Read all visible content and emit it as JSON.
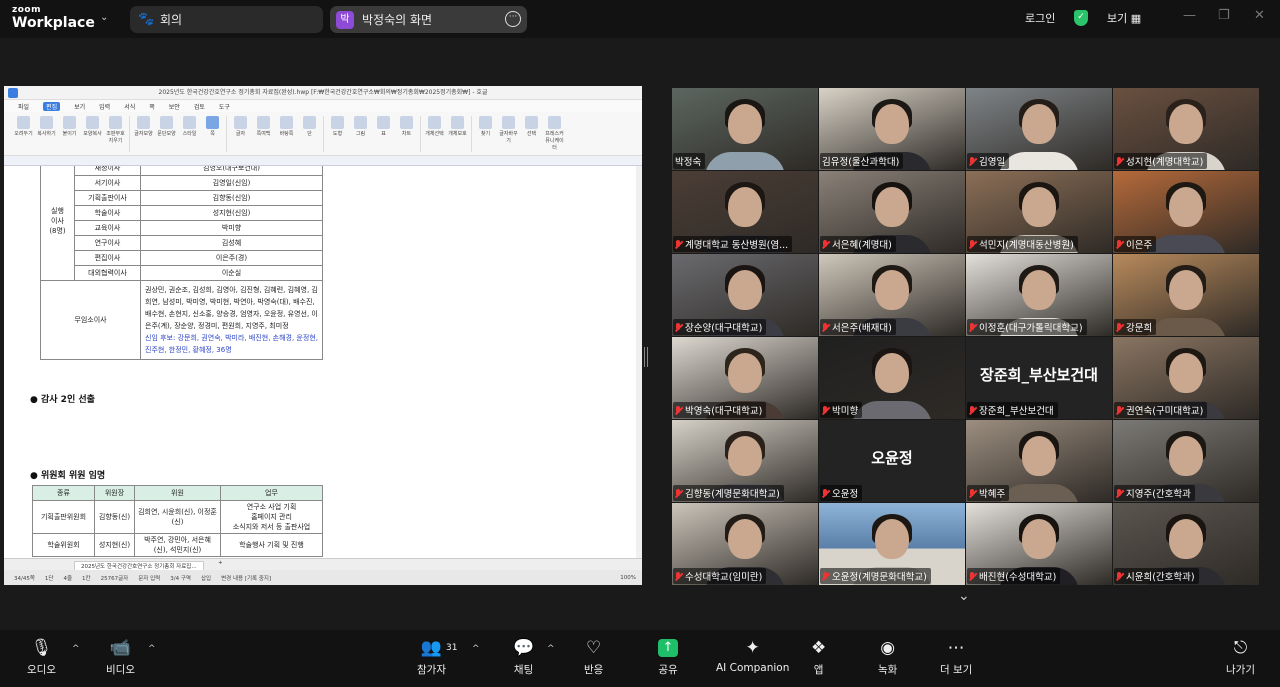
{
  "topbar": {
    "logo_line1": "zoom",
    "logo_line2": "Workplace",
    "meeting_tab": "회의",
    "share_tab": "박정숙의 화면",
    "share_tab_badge": "박",
    "login": "로그인",
    "view": "보기",
    "security_color": "#2bc46b"
  },
  "doc": {
    "title_bar": "2025년도 한국건강간호연구소 정기총회 자료집(완성).hwp [F:₩한국건강간호연구소₩회의₩정기총회₩2025정기총회₩] - 호글",
    "menu": [
      "파일",
      "편집",
      "보기",
      "입력",
      "서식",
      "쪽",
      "보안",
      "검토",
      "도구"
    ],
    "menu_active": 1,
    "ribbon": [
      "오려두기",
      "복사하기",
      "붙이기",
      "모양복사",
      "조판부호지우기",
      "글자모양",
      "문단모양",
      "스타일",
      "쪽",
      "글자",
      "쪽여백",
      "바탕쪽",
      "단",
      "도형",
      "그림",
      "표",
      "차트",
      "개체선택",
      "개체보호",
      "찾기",
      "글자바꾸기",
      "선택",
      "프레스커뮤니케이터"
    ],
    "table1": {
      "group_label": "실행\n이사\n(8명)",
      "rows": [
        {
          "role": "재정이사",
          "person": "김영오(대구보건대)",
          "blue": false
        },
        {
          "role": "서기이사",
          "person": "김영일(신임)",
          "blue": true
        },
        {
          "role": "기획출판이사",
          "person": "김향동(신임)",
          "blue": true,
          "role_blue": true
        },
        {
          "role": "학술이사",
          "person": "성지현(신임)",
          "blue": true
        },
        {
          "role": "교육이사",
          "person": "박미향",
          "blue": false
        },
        {
          "role": "연구이사",
          "person": "김성혜",
          "blue": false
        },
        {
          "role": "편집이사",
          "person": "이은주(경)",
          "blue": false,
          "role_blue": true
        },
        {
          "role": "대외협력이사",
          "person": "이순실",
          "blue": false
        }
      ],
      "board_label": "무임소이사",
      "board_list": "권상민, 권순조, 김성희, 김영아, 김진형, 김혜련, 김혜영, 김희연, 남성미, 박미영, 박미현, 박연아, 박영숙(대), 배수진, 배수현, 손현지, 신소홍, 양승경, 엄영자, 오윤정, 유영선, 이은주(계), 장순양, 정경미, 편원희, 지영주, 최미정",
      "board_list_blue": "신임 후보: 강문희, 권연숙, 박미라, 배진현, 손해경, 윤정현, 진주현, 한정민, 황혜정, 36명"
    },
    "section2": "●  감사 2인 선출",
    "section3": "●  위원회 위원 임명",
    "table2": {
      "headers": [
        "종류",
        "위원장",
        "위원",
        "업무"
      ],
      "rows": [
        {
          "kind": "기획출판위원회",
          "chair": "김향동(신)",
          "members": "김희연, 시윤희(신), 이정훈(신)",
          "duty": "연구소 사업 기획\n홈페이지 관리\n소식지와 저서 등 출판사업"
        },
        {
          "kind": "학술위원회",
          "chair": "성지현(신)",
          "members": "박주연, 강민아, 서은혜(신), 석민지(신)",
          "duty": "학술행사 기획 및 진행"
        }
      ]
    },
    "tab_name": "2025년도 한국건강간호연구소 정기총회 자료집...",
    "status": [
      "34/45쪽",
      "1단",
      "4줄",
      "1칸",
      "25767글자",
      "문자 입력",
      "3/4 구역",
      "삽입",
      "변경 내용 [기록 중지]"
    ],
    "zoom": "100%"
  },
  "participants": [
    {
      "name": "박정숙",
      "muted": false,
      "active": true,
      "bg": "#5c6660",
      "hair": "#1a1613",
      "shirt": "#8fa0ac"
    },
    {
      "name": "김유정(울산과학대)",
      "muted": false,
      "bg": "#d8d2c6",
      "hair": "#1c1815",
      "shirt": "#2a2a2e"
    },
    {
      "name": "김영일",
      "muted": true,
      "bg": "#7f8488",
      "hair": "#241d18",
      "shirt": "#e9e6e0"
    },
    {
      "name": "성지현(계명대학교)",
      "muted": true,
      "bg": "#6a5040",
      "hair": "#2a211b",
      "shirt": "#d8d4cc"
    },
    {
      "name": "계명대학교 동산병원(염...",
      "muted": true,
      "bg": "#4b3e36",
      "hair": "#1c1713",
      "shirt": "#2e2e34"
    },
    {
      "name": "서은혜(계명대)",
      "muted": true,
      "bg": "#8a8178",
      "hair": "#16120f",
      "shirt": "#2b2b2f"
    },
    {
      "name": "석민지(계명대동산병원)",
      "muted": true,
      "bg": "#8c6f57",
      "hair": "#1c1612",
      "shirt": "#c9c2b4"
    },
    {
      "name": "이은주",
      "muted": true,
      "bg": "#b56a3a",
      "hair": "#1e1812",
      "shirt": "#4a4a55"
    },
    {
      "name": "장순양(대구대학교)",
      "muted": true,
      "bg": "#6a6a6e",
      "hair": "#1a1512",
      "shirt": "#3c3c44"
    },
    {
      "name": "서은주(배재대)",
      "muted": true,
      "bg": "#cfc8bb",
      "hair": "#1f1914",
      "shirt": "#3b3b42"
    },
    {
      "name": "이정훈(대구가톨릭대학교)",
      "muted": true,
      "bg": "#e3e0da",
      "hair": "#1f1915",
      "shirt": "#e0ddd8"
    },
    {
      "name": "강문희",
      "muted": true,
      "bg": "#b88a5c",
      "hair": "#231c16",
      "shirt": "#6b5a4a"
    },
    {
      "name": "박영숙(대구대학교)",
      "muted": true,
      "bg": "#ddd8d0",
      "hair": "#2d241c",
      "shirt": "#4a3c34"
    },
    {
      "name": "박미향",
      "muted": true,
      "bg": "#202020",
      "hair": "#1a1512",
      "shirt": "#6a6a70"
    },
    {
      "name": "장준희_부산보건대",
      "muted": true,
      "video_off": true,
      "big": "장준희_부산보건대"
    },
    {
      "name": "권연숙(구미대학교)",
      "muted": true,
      "bg": "#8a7562",
      "hair": "#1e1813",
      "shirt": "#3a3a40"
    },
    {
      "name": "김향동(계명문화대학교)",
      "muted": true,
      "bg": "#d6d1c7",
      "hair": "#2a221a",
      "shirt": "#5a5a60"
    },
    {
      "name": "오윤정",
      "muted": true,
      "video_off": true,
      "big": "오윤정"
    },
    {
      "name": "박혜주",
      "muted": true,
      "bg": "#9c8e80",
      "hair": "#1a1511",
      "shirt": "#6b5e52"
    },
    {
      "name": "지영주(간호학과",
      "muted": true,
      "bg": "#7c7a76",
      "hair": "#1c1713",
      "shirt": "#3a3a3e"
    },
    {
      "name": "수성대학교(임미란)",
      "muted": true,
      "bg": "#cbc5ba",
      "hair": "#231c16",
      "shirt": "#2e2e33"
    },
    {
      "name": "오윤정(계명문화대학교)",
      "muted": true,
      "bg": "#5a7fa8",
      "hair": "#1c1712",
      "shirt": "#b9b4ac",
      "landscape": true
    },
    {
      "name": "배진현(수성대학교)",
      "muted": true,
      "bg": "#e4e1db",
      "hair": "#18130f",
      "shirt": "#1f1f24"
    },
    {
      "name": "시윤희(간호학과)",
      "muted": true,
      "bg": "#5b564f",
      "hair": "#1a1511",
      "shirt": "#2b2b30"
    }
  ],
  "toolbar": {
    "audio": "오디오",
    "video": "비디오",
    "participants": "참가자",
    "participant_count": "31",
    "chat": "채팅",
    "react": "반응",
    "share": "공유",
    "ai": "AI Companion",
    "apps": "앱",
    "record": "녹화",
    "more": "더 보기",
    "leave": "나가기",
    "share_color": "#1fbf6a",
    "leave_color": "#e33333"
  }
}
